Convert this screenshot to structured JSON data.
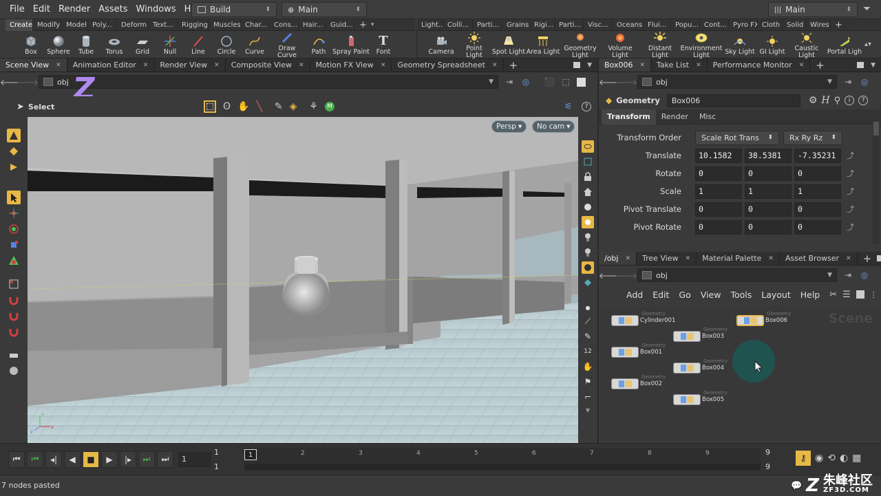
{
  "menubar": {
    "items": [
      "File",
      "Edit",
      "Render",
      "Assets",
      "Windows",
      "Help"
    ],
    "desktop": "Build",
    "context": "Main",
    "right_desktop": "Main"
  },
  "shelf_left": {
    "tabs": [
      "Create",
      "Modify",
      "Model",
      "Poly...",
      "Deform",
      "Text...",
      "Rigging",
      "Muscles",
      "Char...",
      "Cons...",
      "Hair...",
      "Guid..."
    ],
    "tools": [
      {
        "label": "Box",
        "icon": "box-icon"
      },
      {
        "label": "Sphere",
        "icon": "sphere-icon"
      },
      {
        "label": "Tube",
        "icon": "tube-icon"
      },
      {
        "label": "Torus",
        "icon": "torus-icon"
      },
      {
        "label": "Grid",
        "icon": "grid-icon"
      },
      {
        "label": "Null",
        "icon": "null-icon"
      },
      {
        "label": "Line",
        "icon": "line-icon"
      },
      {
        "label": "Circle",
        "icon": "circle-icon"
      },
      {
        "label": "Curve",
        "icon": "curve-icon"
      },
      {
        "label": "Draw Curve",
        "icon": "draw-curve-icon"
      },
      {
        "label": "Path",
        "icon": "path-icon"
      },
      {
        "label": "Spray Paint",
        "icon": "spray-paint-icon"
      },
      {
        "label": "Font",
        "icon": "font-icon"
      }
    ]
  },
  "shelf_right": {
    "tabs": [
      "Light...",
      "Colli...",
      "Parti...",
      "Grains",
      "Rigi...",
      "Parti...",
      "Visc...",
      "Oceans",
      "Flui...",
      "Popu...",
      "Cont...",
      "Pyro FX",
      "Cloth",
      "Solid",
      "Wires"
    ],
    "tools": [
      {
        "label": "Camera",
        "icon": "camera-icon"
      },
      {
        "label": "Point Light",
        "icon": "point-light-icon"
      },
      {
        "label": "Spot Light",
        "icon": "spot-light-icon"
      },
      {
        "label": "Area Light",
        "icon": "area-light-icon"
      },
      {
        "label": "Geometry Light",
        "icon": "geometry-light-icon"
      },
      {
        "label": "Volume Light",
        "icon": "volume-light-icon"
      },
      {
        "label": "Distant Light",
        "icon": "distant-light-icon"
      },
      {
        "label": "Environment Light",
        "icon": "environment-light-icon"
      },
      {
        "label": "Sky Light",
        "icon": "sky-light-icon"
      },
      {
        "label": "GI Light",
        "icon": "gi-light-icon"
      },
      {
        "label": "Caustic Light",
        "icon": "caustic-light-icon"
      },
      {
        "label": "Portal Ligh",
        "icon": "portal-light-icon"
      }
    ]
  },
  "viewer": {
    "tabs": [
      "Scene View",
      "Animation Editor",
      "Render View",
      "Composite View",
      "Motion FX View",
      "Geometry Spreadsheet"
    ],
    "path": "obj",
    "tool_label": "Select",
    "camera_mode": "Persp",
    "camera_name": "No cam",
    "overlay_letter": "Z"
  },
  "params": {
    "tabs": [
      "Box006",
      "Take List",
      "Performance Monitor"
    ],
    "path": "obj",
    "node_type": "Geometry",
    "node_name": "Box006",
    "sub_tabs": [
      "Transform",
      "Render",
      "Misc"
    ],
    "transform_order_label": "Transform Order",
    "transform_order": "Scale Rot Trans",
    "rotate_order": "Rx Ry Rz",
    "rows": [
      {
        "label": "Translate",
        "values": [
          "10.1582",
          "38.5381",
          "-7.35231"
        ]
      },
      {
        "label": "Rotate",
        "values": [
          "0",
          "0",
          "0"
        ]
      },
      {
        "label": "Scale",
        "values": [
          "1",
          "1",
          "1"
        ]
      },
      {
        "label": "Pivot Translate",
        "values": [
          "0",
          "0",
          "0"
        ]
      },
      {
        "label": "Pivot Rotate",
        "values": [
          "0",
          "0",
          "0"
        ]
      }
    ]
  },
  "network": {
    "tabs": [
      "/obj",
      "Tree View",
      "Material Palette",
      "Asset Browser"
    ],
    "path": "obj",
    "menu": [
      "Add",
      "Edit",
      "Go",
      "View",
      "Tools",
      "Layout",
      "Help"
    ],
    "watermark": "Scene",
    "node_type": "Geometry",
    "nodes": [
      "Cylinder001",
      "Box003",
      "Box006",
      "Box001",
      "Box004",
      "Box002",
      "Box005"
    ]
  },
  "timeline": {
    "current_frame": "1",
    "start_frame": "1",
    "start_frame2": "1",
    "end_frame": "9",
    "end_frame2": "9",
    "ticks": [
      "1",
      "2",
      "3",
      "4",
      "5",
      "6",
      "7",
      "8",
      "9"
    ]
  },
  "status": {
    "message": "7 nodes pasted",
    "watermark_text": "朱峰社区",
    "watermark_url": "ZF3D.COM"
  },
  "colors": {
    "accent": "#e8b847",
    "cursor_ring": "#1f5350",
    "z_overlay": "#b089f0"
  }
}
